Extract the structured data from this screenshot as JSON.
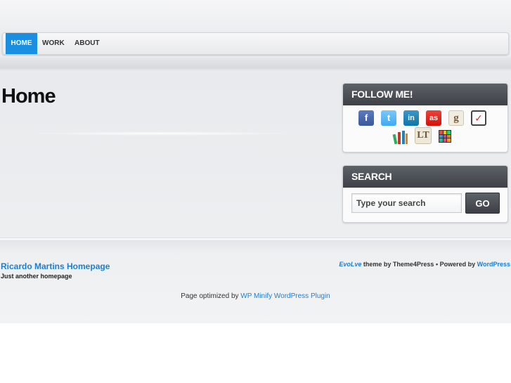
{
  "nav": {
    "items": [
      {
        "label": "HOME",
        "active": true
      },
      {
        "label": "WORK",
        "active": false
      },
      {
        "label": "ABOUT",
        "active": false
      }
    ],
    "active_color": "#1a8ee1"
  },
  "content": {
    "title": "Home"
  },
  "follow_widget": {
    "title": "FOLLOW ME!",
    "icons": [
      {
        "name": "facebook-icon",
        "glyph": "f",
        "color": "#3b5998"
      },
      {
        "name": "twitter-icon",
        "glyph": "t",
        "color": "#3fa9f5"
      },
      {
        "name": "linkedin-icon",
        "glyph": "in",
        "color": "#0e76a8"
      },
      {
        "name": "lastfm-icon",
        "glyph": "as",
        "color": "#d51007"
      },
      {
        "name": "goodreads-icon",
        "glyph": "g",
        "color": "#e9e3d4"
      },
      {
        "name": "todoist-icon",
        "glyph": "✓",
        "color": "#444444"
      },
      {
        "name": "bookshelf-icon",
        "glyph": "",
        "color": "#c0392b"
      },
      {
        "name": "librarything-icon",
        "glyph": "LT",
        "color": "#e8e0d0"
      },
      {
        "name": "mosaic-icon",
        "glyph": "",
        "color": "#8e44ad"
      }
    ]
  },
  "search_widget": {
    "title": "SEARCH",
    "placeholder": "Type your search",
    "button_label": "GO"
  },
  "footer": {
    "site_name": "Ricardo Martins Homepage",
    "tagline": "Just another homepage",
    "theme_name": "EvoLve",
    "theme_by": " theme by Theme4Press",
    "separator": "•",
    "powered_by": "Powered by ",
    "wordpress": "WordPress",
    "optimized_prefix": "Page optimized by ",
    "optimized_link": "WP Minify WordPress Plugin",
    "link_color": "#1a7fd4"
  }
}
